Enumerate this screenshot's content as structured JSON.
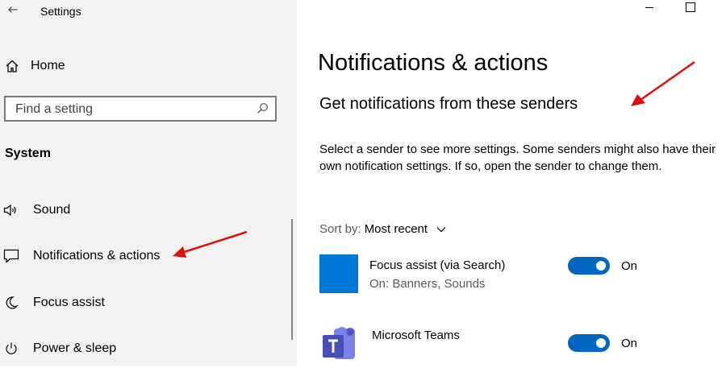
{
  "window": {
    "title": "Settings"
  },
  "sidebar": {
    "home_label": "Home",
    "search_placeholder": "Find a setting",
    "section_label": "System",
    "items": [
      {
        "label": "Sound",
        "icon": "speaker-icon"
      },
      {
        "label": "Notifications & actions",
        "icon": "notification-icon"
      },
      {
        "label": "Focus assist",
        "icon": "moon-icon"
      },
      {
        "label": "Power & sleep",
        "icon": "power-icon"
      }
    ]
  },
  "main": {
    "title": "Notifications & actions",
    "subtitle": "Get notifications from these senders",
    "description": "Select a sender to see more settings. Some senders might also have their own notification settings. If so, open the sender to change them.",
    "sort_label": "Sort by:",
    "sort_value": "Most recent",
    "senders": [
      {
        "name": "Focus assist (via Search)",
        "status": "On: Banners, Sounds",
        "toggle_label": "On",
        "toggle_on": true
      },
      {
        "name": "Microsoft Teams",
        "status": "",
        "toggle_label": "On",
        "toggle_on": true
      }
    ]
  },
  "colors": {
    "accent": "#0067c0",
    "tile_blue": "#0078d7",
    "teams_purple": "#464eb8",
    "annotation_red": "#e01010",
    "sidebar_bg": "#f2f2f2"
  }
}
